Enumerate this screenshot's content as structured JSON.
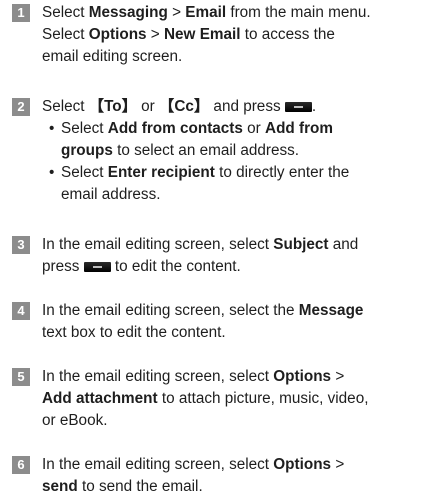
{
  "steps": [
    {
      "num": "1",
      "lines": [
        [
          "Select ",
          {
            "b": "Messaging"
          },
          " > ",
          {
            "b": "Email"
          },
          " from the main menu."
        ],
        [
          "Select ",
          {
            "b": "Options"
          },
          " > ",
          {
            "b": "New Email"
          },
          " to access the"
        ],
        [
          "email editing screen."
        ]
      ]
    },
    {
      "num": "2",
      "lines": [
        [
          "Select ",
          {
            "b": "【To】"
          },
          " or ",
          {
            "b": "【Cc】"
          },
          " and press ",
          {
            "key": "menu-key"
          },
          "."
        ]
      ],
      "bullets": [
        {
          "lines": [
            [
              "Select ",
              {
                "b": "Add from contacts"
              },
              " or ",
              {
                "b": "Add from"
              }
            ],
            [
              {
                "b": "groups"
              },
              " to select an email address."
            ]
          ]
        },
        {
          "lines": [
            [
              "Select ",
              {
                "b": "Enter recipient"
              },
              " to directly enter the"
            ],
            [
              "email address."
            ]
          ]
        }
      ]
    },
    {
      "num": "3",
      "lines": [
        [
          "In the email editing screen, select ",
          {
            "b": "Subject"
          },
          " and"
        ],
        [
          "press ",
          {
            "key": "menu-key"
          },
          " to edit the content."
        ]
      ]
    },
    {
      "num": "4",
      "lines": [
        [
          "In the email editing screen, select the ",
          {
            "b": "Message"
          }
        ],
        [
          "text box to edit the content."
        ]
      ]
    },
    {
      "num": "5",
      "lines": [
        [
          "In the email editing screen, select ",
          {
            "b": "Options"
          },
          " >"
        ],
        [
          {
            "b": "Add attachment"
          },
          " to attach picture, music, video,"
        ],
        [
          "or eBook."
        ]
      ]
    },
    {
      "num": "6",
      "lines": [
        [
          "In the email editing screen, select ",
          {
            "b": "Options"
          },
          " >"
        ],
        [
          {
            "b": "send"
          },
          " to send the email."
        ]
      ]
    }
  ],
  "bullet_char": "•",
  "colors": {
    "text": "#1e1e1e",
    "number_badge": "#8c8c8c",
    "key": "#111111"
  }
}
